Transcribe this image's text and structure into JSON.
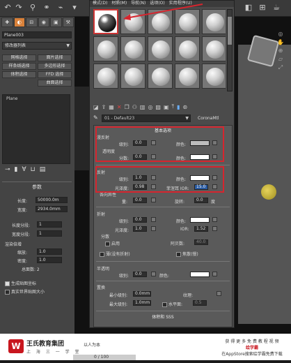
{
  "top_menu": [
    "模式(D)",
    "材质(M)",
    "导航(N)",
    "选项(O)",
    "实用程序(U)"
  ],
  "left_panel": {
    "tabs": [
      "创建",
      "修改",
      "层次",
      "运动",
      "显示",
      "工具"
    ],
    "object_name": "Plane003",
    "modifier_list": "修改器列表",
    "buttons": [
      "网格选择",
      "面片选择",
      "样条线选择",
      "多边形选择",
      "体积选择",
      "FFD 选择",
      "",
      "曲面选择"
    ],
    "stack_item": "Plane",
    "params_title": "参数",
    "length_label": "长度:",
    "length_value": "50000.0m",
    "width_label": "宽度:",
    "width_value": "2934.0mm",
    "length_segs_label": "长度分段:",
    "length_segs_value": "1",
    "width_segs_label": "宽度分段:",
    "width_segs_value": "1",
    "render_mult_label": "渲染倍增",
    "scale_label": "缩放:",
    "scale_value": "1.0",
    "density_label": "密度:",
    "density_value": "1.0",
    "total_faces": "总面数: 2",
    "gen_uv_label": "生成贴图坐标",
    "real_world_label": "真实世界贴图大小"
  },
  "material_editor": {
    "material_name": "01 - Default23",
    "material_type": "CoronaMtl",
    "basic_options": "基本选项",
    "diffuse": {
      "title": "漫反射",
      "level_label": "级别:",
      "level_value": "0.0",
      "color_label": "颜色:",
      "translucency_label": "透明度",
      "fraction_label": "分数:",
      "fraction_value": "0.0",
      "translucency_color_label": "颜色:"
    },
    "reflection": {
      "title": "反射",
      "level_label": "级别:",
      "level_value": "1.0",
      "color_label": "颜色:",
      "gloss_label": "光泽度:",
      "gloss_value": "0.98",
      "fresnel_label": "菲涅耳 IOR:",
      "fresnel_value": "15.0",
      "aniso_label": "各向异性",
      "amount_label": "量:",
      "amount_value": "0.0",
      "rotation_label": "旋转:",
      "rotation_value": "0.0",
      "deg_label": "度"
    },
    "refraction": {
      "title": "折射",
      "level_label": "级别:",
      "level_value": "0.0",
      "color_label": "颜色:",
      "gloss_label": "光泽度:",
      "gloss_value": "1.0",
      "ior_label": "IOR:",
      "ior_value": "1.52",
      "dispersion_label": "分散",
      "enable_label": "启用",
      "abbe_label": "阿贝数:",
      "abbe_value": "40.0",
      "thin_label": "薄(没有折射)",
      "caustics_label": "焦散(慢)"
    },
    "translucency": {
      "title": "半透明",
      "level_label": "级别:",
      "level_value": "0.0",
      "color_label": "颜色:"
    },
    "displacement": {
      "title": "置换",
      "min_label": "最小级别:",
      "min_value": "0.0mm",
      "texture_label": "纹理:",
      "max_label": "最大级别:",
      "max_value": "1.0mm",
      "water_label": "水平面:",
      "water_value": "0.5"
    },
    "volume_sss": "体积和 SSS"
  },
  "footer": {
    "brand": "王氏教育集团",
    "brand_sub": "上 海 三 一 学 堂",
    "brand_tag": "以人为本",
    "right_line1": "获 得 更 多 免 费 教 程 视 频",
    "right_logo": "绘学霸",
    "right_line2": "在AppStore搜索绘学霸免费下载",
    "frame": "0 / 100"
  },
  "colors": {
    "selection_red": "#d6252e",
    "accent_orange": "#d9813a",
    "fresnel_highlight": "#2a5aa0",
    "brand_red": "#c8161e"
  }
}
